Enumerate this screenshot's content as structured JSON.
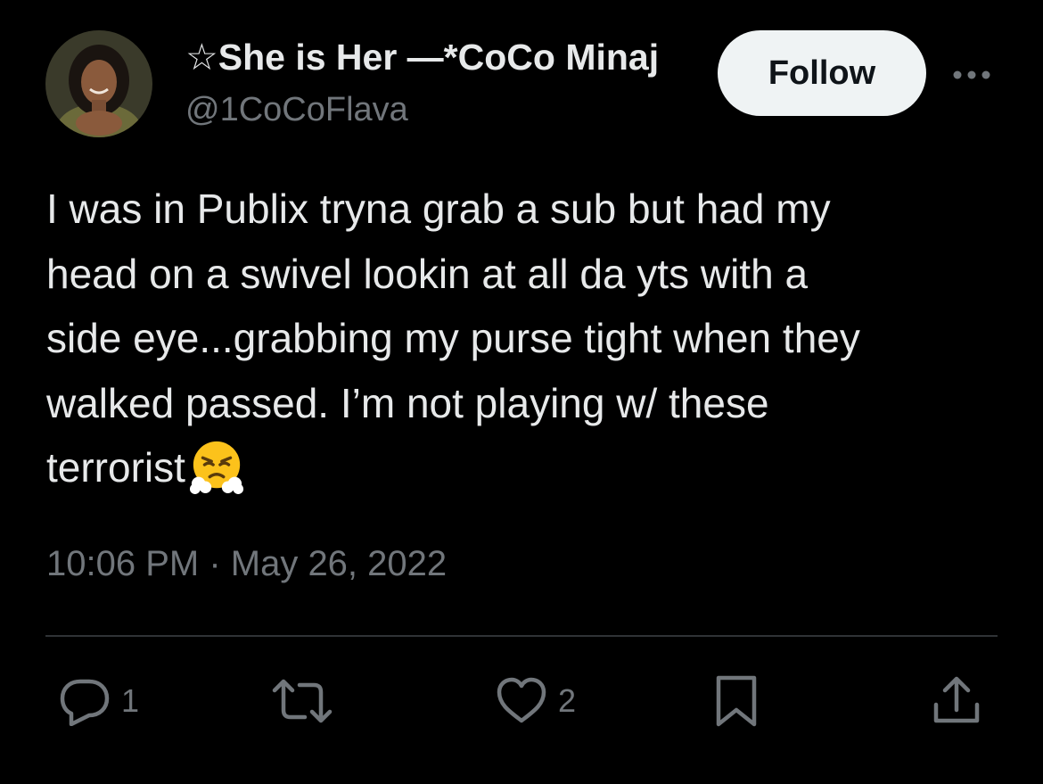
{
  "author": {
    "display_name": "☆She is Her —*CoCo Minaj",
    "handle": "@1CoCoFlava"
  },
  "header": {
    "follow_label": "Follow"
  },
  "tweet": {
    "text": "I was in Publix tryna grab a sub but had my\nhead on a swivel lookin at all da yts with a\nside eye...grabbing my purse tight when they\nwalked passed. I’m not playing w/ these\nterrorist",
    "emoji": "face-with-steam-from-nose",
    "timestamp": "10:06 PM · May 26, 2022"
  },
  "actions": {
    "reply_count": "1",
    "like_count": "2"
  },
  "colors": {
    "background": "#000000",
    "text": "#e7e9ea",
    "secondary": "#71767b",
    "divider": "#2f3336",
    "follow_bg": "#eff3f4",
    "follow_text": "#0f1419"
  }
}
